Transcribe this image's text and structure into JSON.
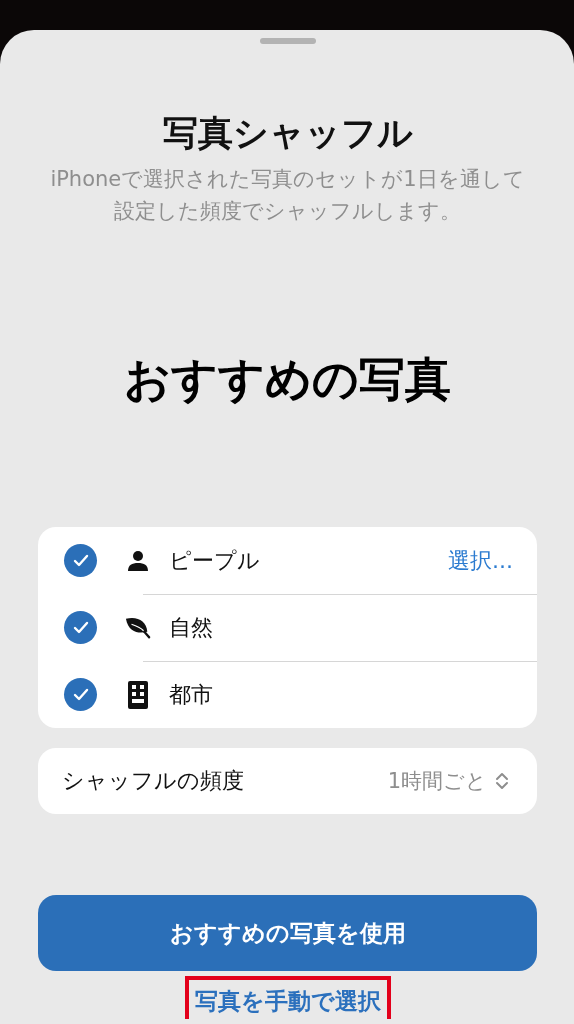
{
  "sheet": {
    "title": "写真シャッフル",
    "description": "iPhoneで選択された写真のセットが1日を通して設定した頻度でシャッフルします。"
  },
  "heading": "おすすめの写真",
  "categories": [
    {
      "kind": "person",
      "label": "ピープル",
      "checked": true,
      "action": "選択..."
    },
    {
      "kind": "leaf",
      "label": "自然",
      "checked": true
    },
    {
      "kind": "building",
      "label": "都市",
      "checked": true
    }
  ],
  "frequency": {
    "label": "シャッフルの頻度",
    "value": "1時間ごと"
  },
  "primary_button": "おすすめの写真を使用",
  "link": {
    "label": "写真を手動で選択",
    "highlighted": true
  }
}
